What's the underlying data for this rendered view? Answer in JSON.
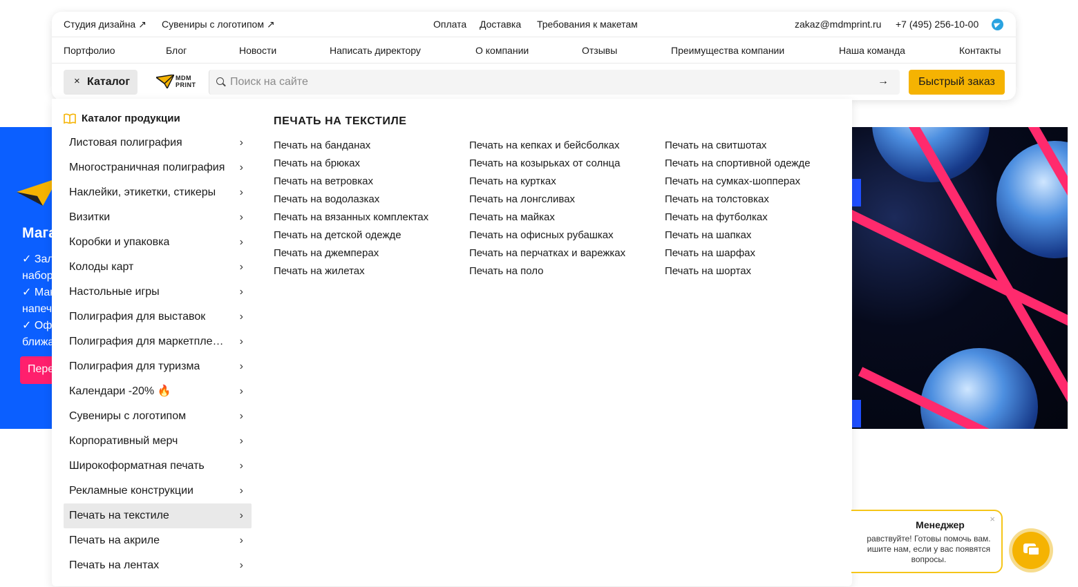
{
  "header": {
    "top_links": [
      {
        "label": "Студия дизайна ↗"
      },
      {
        "label": "Сувениры с логотипом ↗"
      }
    ],
    "center_links": [
      "Оплата",
      "Доставка",
      "Требования к макетам"
    ],
    "email": "zakaz@mdmprint.ru",
    "phone": "+7 (495) 256-10-00",
    "nav": [
      "Портфолио",
      "Блог",
      "Новости",
      "Написать директору",
      "О компании",
      "Отзывы",
      "Преимущества компании",
      "Наша команда",
      "Контакты"
    ],
    "catalog_button": "Каталог",
    "catalog_close": "×",
    "logo_line1": "MDM",
    "logo_line2": "PRINT",
    "search_placeholder": "Поиск на сайте",
    "search_arrow": "→",
    "quick_order": "Быстрый заказ"
  },
  "menu": {
    "heading": "Каталог продукции",
    "categories": [
      "Листовая полиграфия",
      "Многостраничная полиграфия",
      "Наклейки, этикетки, стикеры",
      "Визитки",
      "Коробки и упаковка",
      "Колоды карт",
      "Настольные игры",
      "Полиграфия для выставок",
      "Полиграфия для маркетплейсов",
      "Полиграфия для туризма",
      "Календари -20% 🔥",
      "Сувениры с логотипом",
      "Корпоративный мерч",
      "Широкоформатная печать",
      "Рекламные конструкции",
      "Печать на текстиле",
      "Печать на акриле",
      "Печать на лентах"
    ],
    "active_index": 15,
    "chevron": "›",
    "sub_title": "ПЕЧАТЬ НА ТЕКСТИЛЕ",
    "sub_columns": [
      [
        "Печать на банданах",
        "Печать на брюках",
        "Печать на ветровках",
        "Печать на водолазках",
        "Печать на вязанных комплектах",
        "Печать на детской одежде",
        "Печать на джемперах",
        "Печать на жилетах"
      ],
      [
        "Печать на кепках и бейсболках",
        "Печать на козырьках от солнца",
        "Печать на куртках",
        "Печать на лонгсливах",
        "Печать на майках",
        "Печать на офисных рубашках",
        "Печать на перчатках и варежках",
        "Печать на поло"
      ],
      [
        "Печать на свитшотах",
        "Печать на спортивной одежде",
        "Печать на сумках-шопперах",
        "Печать на толстовках",
        "Печать на футболках",
        "Печать на шапках",
        "Печать на шарфах",
        "Печать на шортах"
      ]
    ]
  },
  "hero": {
    "title": "Мага",
    "lines": [
      "✓ Зал",
      "набор",
      "✓ Мак",
      "напеч",
      "✓ Офо",
      "ближа"
    ],
    "button": "Пере"
  },
  "manager": {
    "title": "Менеджер",
    "text": "равствуйте! Готовы помочь вам. ишите нам, если у вас появятся вопросы.",
    "close": "×"
  },
  "colors": {
    "accent": "#f5b302",
    "hero_blue": "#0b5fff",
    "hero_pink": "#ff1f6d",
    "telegram": "#2aa3e0"
  }
}
